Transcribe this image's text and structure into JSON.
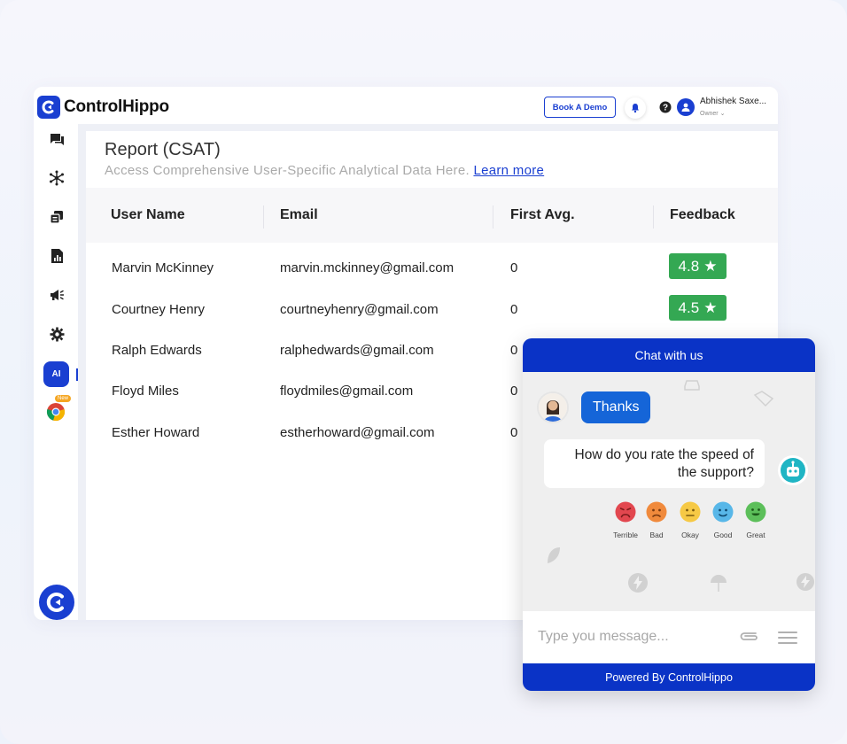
{
  "header": {
    "brand": "ControlHippo",
    "book_demo_label": "Book A Demo",
    "user_name": "Abhishek Saxe...",
    "user_role": "Owner"
  },
  "sidebar": {
    "ai_label": "AI",
    "new_badge": "New"
  },
  "report": {
    "title": "Report (CSAT)",
    "subtitle": "Access Comprehensive User-Specific Analytical Data Here.",
    "learn_more": "Learn more",
    "columns": [
      "User Name",
      "Email",
      "First Avg.",
      "Feedback"
    ],
    "rows": [
      {
        "name": "Marvin McKinney",
        "email": "marvin.mckinney@gmail.com",
        "first_avg": "0",
        "feedback": "4.8"
      },
      {
        "name": "Courtney Henry",
        "email": "courtneyhenry@gmail.com",
        "first_avg": "0",
        "feedback": "4.5"
      },
      {
        "name": "Ralph Edwards",
        "email": "ralphedwards@gmail.com",
        "first_avg": "0",
        "feedback": ""
      },
      {
        "name": "Floyd Miles",
        "email": "floydmiles@gmail.com",
        "first_avg": "0",
        "feedback": ""
      },
      {
        "name": "Esther Howard",
        "email": "estherhoward@gmail.com",
        "first_avg": "0",
        "feedback": ""
      }
    ]
  },
  "chat": {
    "header": "Chat with us",
    "user_message": "Thanks",
    "bot_question": "How do you rate the speed of the support?",
    "ratings": [
      {
        "label": "Terrible",
        "color": "#e2474f"
      },
      {
        "label": "Bad",
        "color": "#f08a3c"
      },
      {
        "label": "Okay",
        "color": "#f6c945"
      },
      {
        "label": "Good",
        "color": "#58b7e8"
      },
      {
        "label": "Great",
        "color": "#5cbf5a"
      }
    ],
    "input_placeholder": "Type you message...",
    "footer": "Powered By ControlHippo"
  },
  "colors": {
    "brand_blue": "#1a3fd1",
    "chat_blue": "#0a33c6",
    "feedback_green": "#34a853"
  }
}
